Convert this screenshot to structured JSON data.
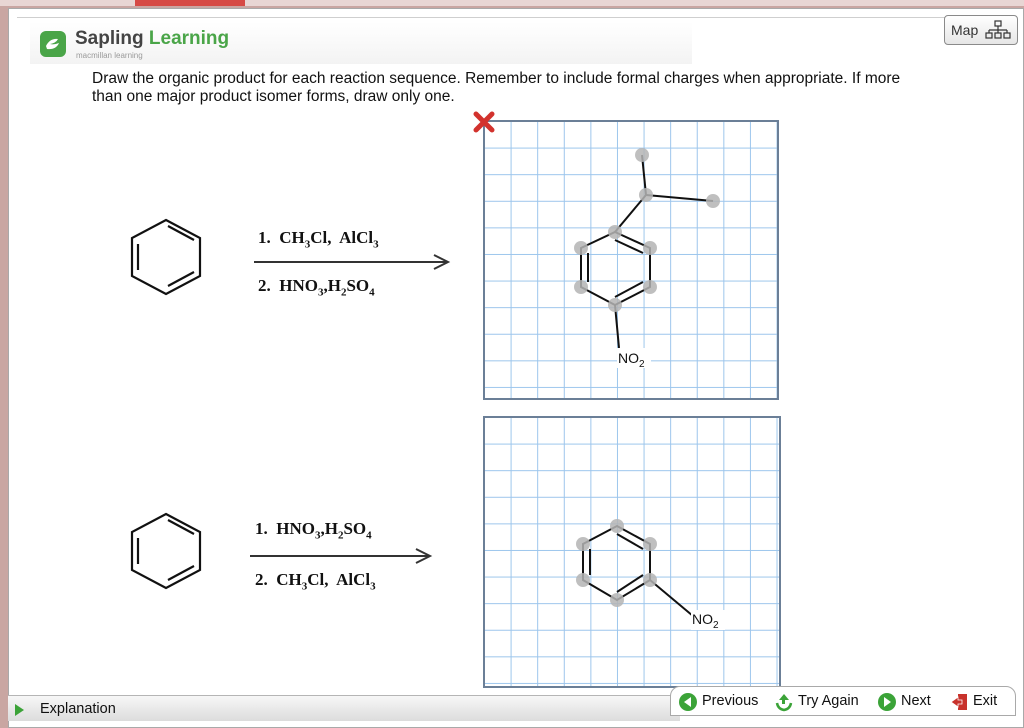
{
  "brand": {
    "name_part1": "Sapling",
    "name_part2": "Learning",
    "subtitle": "macmillan learning",
    "accent_color": "#4aa548"
  },
  "header": {
    "map_label": "Map",
    "map_icon": "sitemap-icon"
  },
  "question": {
    "text": "Draw the organic product for each reaction sequence. Remember to include formal charges when appropriate. If more than one major product isomer forms, draw only one."
  },
  "reaction1": {
    "step1": "1.",
    "step1_reagent1": "CH",
    "step1_reagent1_sub": "3",
    "step1_reagent1_tail": "Cl,",
    "step1_reagent2": "AlCl",
    "step1_reagent2_sub": "3",
    "step2": "2.",
    "step2_reagent1": "HNO",
    "step2_reagent1_sub": "3",
    "step2_sep": ",H",
    "step2_reagent2_sub": "2",
    "step2_reagent2": "SO",
    "step2_reagent2_sub2": "4"
  },
  "reaction2": {
    "step1": "1.",
    "step1_reagent1": "HNO",
    "step1_reagent1_sub": "3",
    "step1_sep": ",H",
    "step1_reagent2_sub": "2",
    "step1_reagent2": "SO",
    "step1_reagent2_sub2": "4",
    "step2": "2.",
    "step2_reagent1": "CH",
    "step2_reagent1_sub": "3",
    "step2_reagent1_tail": "Cl,",
    "step2_reagent2": "AlCl",
    "step2_reagent2_sub": "3"
  },
  "canvas1": {
    "group_label": "NO",
    "group_sub": "2"
  },
  "canvas2": {
    "group_label": "NO",
    "group_sub": "2"
  },
  "footer": {
    "explanation_label": "Explanation",
    "previous_label": "Previous",
    "try_again_label": "Try Again",
    "next_label": "Next",
    "exit_label": "Exit"
  },
  "colors": {
    "grid_line": "#9cc5ec",
    "grid_border": "#6b7f97",
    "atom_dot": "#b5b5b5",
    "nav_green": "#3ba338",
    "exit_red": "#c8322c"
  }
}
